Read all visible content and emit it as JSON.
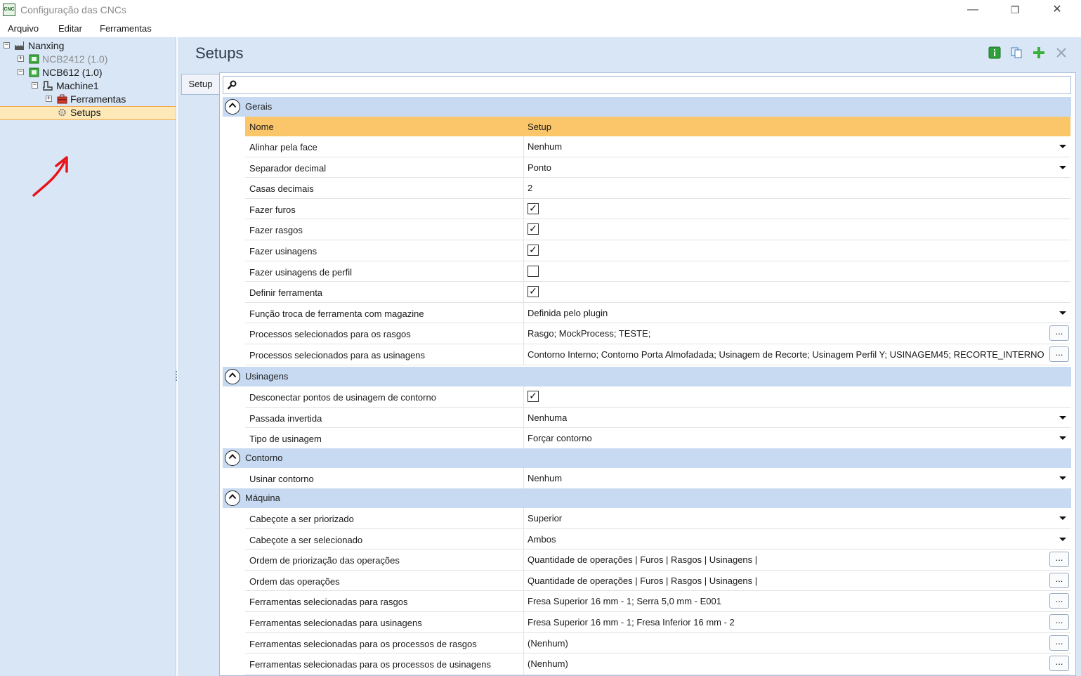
{
  "window": {
    "title": "Configuração das CNCs",
    "app_icon_text": "CNC",
    "minimize": "—",
    "restore": "❐",
    "close": "✕"
  },
  "menu": {
    "items": [
      "Arquivo",
      "Editar",
      "Ferramentas"
    ]
  },
  "tree": {
    "items": [
      {
        "label": "Nanxing",
        "expander": "−",
        "icon": "factory-icon",
        "color": "#1a1a1a"
      },
      {
        "label": "NCB2412 (1.0)",
        "expander": "+",
        "icon": "cnc-board-icon",
        "color": "#8a8a8a"
      },
      {
        "label": "NCB612 (1.0)",
        "expander": "−",
        "icon": "cnc-board-icon",
        "color": "#1a1a1a"
      },
      {
        "label": "Machine1",
        "expander": "−",
        "icon": "machine-icon",
        "color": "#1a1a1a"
      },
      {
        "label": "Ferramentas",
        "expander": "+",
        "icon": "toolbox-icon",
        "color": "#1a1a1a"
      },
      {
        "label": "Setups",
        "expander": "",
        "icon": "gear-icon",
        "color": "#1a1a1a",
        "selected": true
      }
    ]
  },
  "panel": {
    "title": "Setups",
    "tab": "Setup",
    "search_placeholder": ""
  },
  "grid": {
    "header": {
      "name": "Nome",
      "value": "Setup"
    },
    "categories": [
      {
        "label": "Gerais",
        "rows": [
          {
            "name": "Alinhar pela face",
            "type": "dropdown",
            "value": "Nenhum"
          },
          {
            "name": "Separador decimal",
            "type": "dropdown",
            "value": "Ponto"
          },
          {
            "name": "Casas decimais",
            "type": "text",
            "value": "2"
          },
          {
            "name": "Fazer furos",
            "type": "checkbox",
            "checked": true
          },
          {
            "name": "Fazer rasgos",
            "type": "checkbox",
            "checked": true
          },
          {
            "name": "Fazer usinagens",
            "type": "checkbox",
            "checked": true
          },
          {
            "name": "Fazer usinagens de perfil",
            "type": "checkbox",
            "checked": false
          },
          {
            "name": "Definir ferramenta",
            "type": "checkbox",
            "checked": true
          },
          {
            "name": "Função troca de ferramenta com magazine",
            "type": "dropdown",
            "value": "Definida pelo plugin"
          },
          {
            "name": "Processos selecionados para os rasgos",
            "type": "ellipsis",
            "value": "Rasgo; MockProcess; TESTE;"
          },
          {
            "name": "Processos selecionados para as usinagens",
            "type": "ellipsis",
            "value": "Contorno Interno; Contorno Porta Almofadada; Usinagem de Recorte; Usinagem Perfil Y; USINAGEM45; RECORTE_INTERNO"
          }
        ]
      },
      {
        "label": "Usinagens",
        "rows": [
          {
            "name": "Desconectar pontos de usinagem de contorno",
            "type": "checkbox",
            "checked": true
          },
          {
            "name": "Passada invertida",
            "type": "dropdown",
            "value": "Nenhuma"
          },
          {
            "name": "Tipo de usinagem",
            "type": "dropdown",
            "value": "Forçar contorno"
          }
        ]
      },
      {
        "label": "Contorno",
        "rows": [
          {
            "name": "Usinar contorno",
            "type": "dropdown",
            "value": "Nenhum"
          }
        ]
      },
      {
        "label": "Máquina",
        "rows": [
          {
            "name": "Cabeçote a ser priorizado",
            "type": "dropdown",
            "value": "Superior"
          },
          {
            "name": "Cabeçote a ser selecionado",
            "type": "dropdown",
            "value": "Ambos"
          },
          {
            "name": "Ordem de priorização das operações",
            "type": "ellipsis",
            "value": "Quantidade de operações | Furos | Rasgos | Usinagens |"
          },
          {
            "name": "Ordem das operações",
            "type": "ellipsis",
            "value": "Quantidade de operações | Furos | Rasgos | Usinagens |"
          },
          {
            "name": "Ferramentas selecionadas para rasgos",
            "type": "ellipsis",
            "value": "Fresa Superior 16 mm - 1; Serra 5,0 mm - E001"
          },
          {
            "name": "Ferramentas selecionadas para usinagens",
            "type": "ellipsis",
            "value": "Fresa Superior 16 mm - 1; Fresa Inferior 16 mm - 2"
          },
          {
            "name": "Ferramentas selecionadas para os processos de rasgos",
            "type": "ellipsis",
            "value": "(Nenhum)"
          },
          {
            "name": "Ferramentas selecionadas para os processos de usinagens",
            "type": "ellipsis",
            "value": "(Nenhum)"
          }
        ]
      }
    ]
  },
  "ellipsis_label": "...",
  "check_glyph": "✓",
  "colors": {
    "header_orange": "#fbc56a",
    "category_blue": "#c7daf2",
    "panel_blue": "#d8e6f5",
    "selection": "#fde9b8",
    "annotation_red": "#e8141b"
  }
}
